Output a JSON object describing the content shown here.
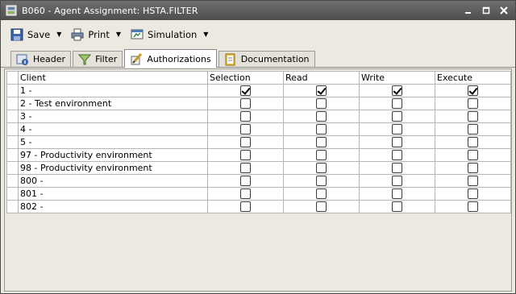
{
  "window": {
    "title": "B060 - Agent Assignment: HSTA.FILTER",
    "controls": [
      "minimize-icon",
      "maximize-icon",
      "close-icon"
    ]
  },
  "toolbar": {
    "save_label": "Save",
    "print_label": "Print",
    "simulation_label": "Simulation"
  },
  "tabs": [
    {
      "label": "Header",
      "icon": "header-icon",
      "active": false
    },
    {
      "label": "Filter",
      "icon": "filter-icon",
      "active": false
    },
    {
      "label": "Authorizations",
      "icon": "authorizations-icon",
      "active": true
    },
    {
      "label": "Documentation",
      "icon": "documentation-icon",
      "active": false
    }
  ],
  "grid": {
    "columns": [
      "Client",
      "Selection",
      "Read",
      "Write",
      "Execute"
    ],
    "rows": [
      {
        "client": "1 -",
        "selection": true,
        "read": true,
        "write": true,
        "execute": true
      },
      {
        "client": "2 - Test environment",
        "selection": false,
        "read": false,
        "write": false,
        "execute": false
      },
      {
        "client": "3 -",
        "selection": false,
        "read": false,
        "write": false,
        "execute": false
      },
      {
        "client": "4 -",
        "selection": false,
        "read": false,
        "write": false,
        "execute": false
      },
      {
        "client": "5 -",
        "selection": false,
        "read": false,
        "write": false,
        "execute": false
      },
      {
        "client": "97 - Productivity environment",
        "selection": false,
        "read": false,
        "write": false,
        "execute": false
      },
      {
        "client": "98 - Productivity environment",
        "selection": false,
        "read": false,
        "write": false,
        "execute": false
      },
      {
        "client": "800 -",
        "selection": false,
        "read": false,
        "write": false,
        "execute": false
      },
      {
        "client": "801 -",
        "selection": false,
        "read": false,
        "write": false,
        "execute": false
      },
      {
        "client": "802 -",
        "selection": false,
        "read": false,
        "write": false,
        "execute": false
      }
    ]
  }
}
